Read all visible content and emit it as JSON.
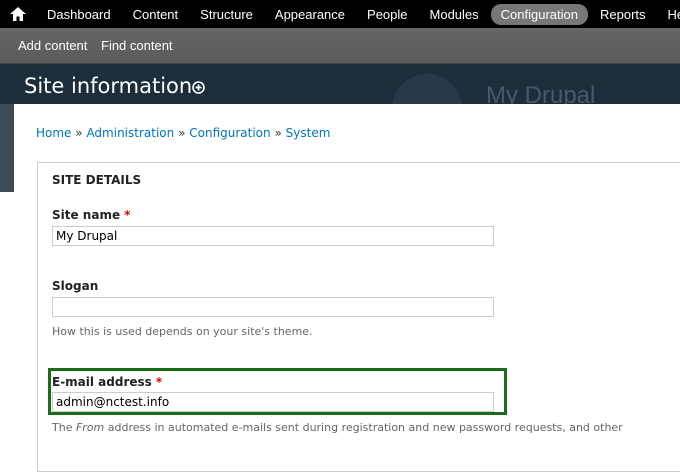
{
  "toolbar": {
    "home_icon": "home-icon",
    "menu": [
      {
        "label": "Dashboard",
        "active": false
      },
      {
        "label": "Content",
        "active": false
      },
      {
        "label": "Structure",
        "active": false
      },
      {
        "label": "Appearance",
        "active": false
      },
      {
        "label": "People",
        "active": false
      },
      {
        "label": "Modules",
        "active": false
      },
      {
        "label": "Configuration",
        "active": true
      },
      {
        "label": "Reports",
        "active": false
      },
      {
        "label": "Help",
        "active": false
      }
    ]
  },
  "shortcuts": {
    "add_content": "Add content",
    "find_content": "Find content"
  },
  "header": {
    "title": "Site information",
    "site_name_background": "My Drupal",
    "add_shortcut_icon": "plus-circle-icon"
  },
  "breadcrumb": {
    "items": [
      "Home",
      "Administration",
      "Configuration",
      "System"
    ],
    "separator": "»"
  },
  "form": {
    "legend": "SITE DETAILS",
    "site_name": {
      "label": "Site name",
      "required_mark": "*",
      "value": "My Drupal"
    },
    "slogan": {
      "label": "Slogan",
      "value": "",
      "description": "How this is used depends on your site's theme."
    },
    "email": {
      "label": "E-mail address",
      "required_mark": "*",
      "value": "admin@nctest.info",
      "description_prefix": "The ",
      "description_em": "From",
      "description_suffix": " address in automated e-mails sent during registration and new password requests, and other"
    }
  },
  "colors": {
    "toolbar_bg": "#000000",
    "shortcuts_bg": "#5e5e5e",
    "header_bg": "#1e2d3c",
    "link": "#0074bd",
    "required": "#e00000",
    "highlight": "#1a6b1a"
  }
}
